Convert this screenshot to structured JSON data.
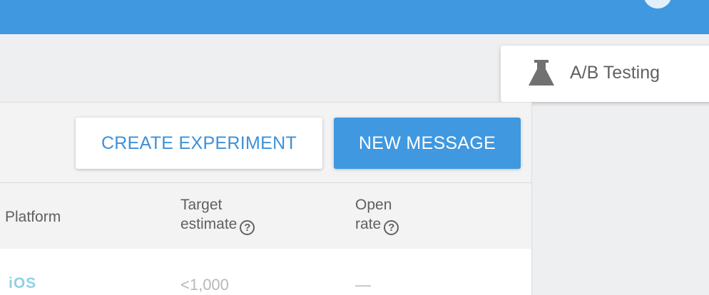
{
  "colors": {
    "accent": "#3f98e0",
    "popup_text": "#616161",
    "ios_badge": "#8fd0e6"
  },
  "popup": {
    "icon": "flask-icon",
    "label": "A/B Testing"
  },
  "toolbar": {
    "create_experiment_label": "CREATE EXPERIMENT",
    "new_message_label": "NEW MESSAGE"
  },
  "table": {
    "columns": [
      {
        "label_line1": "Platform",
        "label_line2": ""
      },
      {
        "label_line1": "Target",
        "label_line2": "estimate",
        "help_icon": "help-circle-icon"
      },
      {
        "label_line1": "Open",
        "label_line2": "rate",
        "help_icon": "help-circle-icon"
      }
    ],
    "help_glyph": "?",
    "rows": [
      {
        "platform": "iOS",
        "target_estimate": "<1,000",
        "open_rate": "—"
      }
    ]
  }
}
